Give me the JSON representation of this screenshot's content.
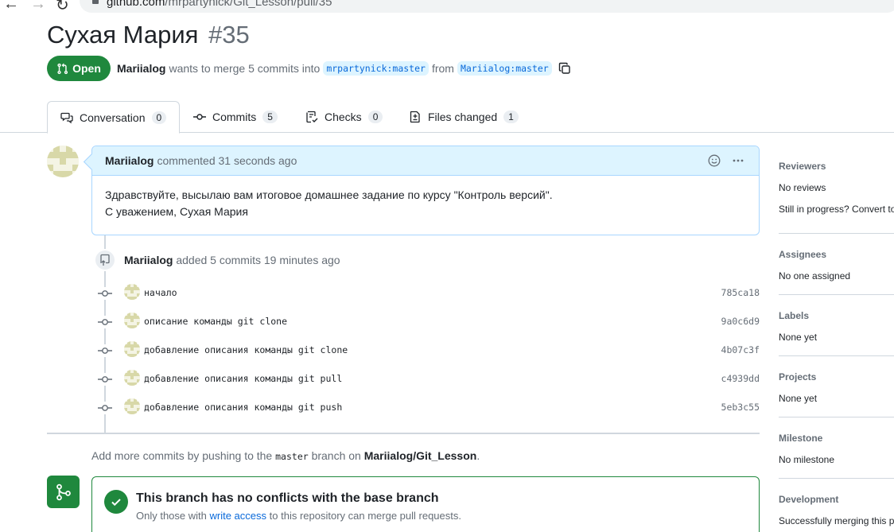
{
  "browser": {
    "url_host": "github.com",
    "url_path": "/mrpartynick/Git_Lesson/pull/35"
  },
  "pr": {
    "title": "Сухая Мария",
    "number": "#35",
    "state": "Open",
    "author": "Mariialog",
    "merge_text": "wants to merge 5 commits into",
    "base_branch": "mrpartynick:master",
    "from_text": "from",
    "head_branch": "Mariialog:master"
  },
  "tabs": [
    {
      "label": "Conversation",
      "count": "0",
      "icon": "comment-discussion-icon"
    },
    {
      "label": "Commits",
      "count": "5",
      "icon": "git-commit-icon"
    },
    {
      "label": "Checks",
      "count": "0",
      "icon": "checklist-icon"
    },
    {
      "label": "Files changed",
      "count": "1",
      "icon": "file-diff-icon"
    }
  ],
  "comment": {
    "author": "Mariialog",
    "action": "commented 31 seconds ago",
    "body_line1": "Здравствуйте, высылаю вам итоговое домашнее задание по курсу \"Контроль версий\".",
    "body_line2": "С уважением, Сухая Мария"
  },
  "commits_event": {
    "author": "Mariialog",
    "action": "added 5 commits 19 minutes ago"
  },
  "commits": [
    {
      "message": "начало",
      "sha": "785ca18"
    },
    {
      "message": "описание команды git clone",
      "sha": "9a0c6d9"
    },
    {
      "message": "добавление описания команды git clone",
      "sha": "4b07c3f"
    },
    {
      "message": "добавление описания команды git pull",
      "sha": "c4939dd"
    },
    {
      "message": "добавление описания команды git push",
      "sha": "5eb3c55"
    }
  ],
  "add_commits": {
    "prefix": "Add more commits by pushing to the",
    "branch": "master",
    "middle": "branch on",
    "repo": "Mariialog/Git_Lesson",
    "suffix": "."
  },
  "merge_status": {
    "title": "This branch has no conflicts with the base branch",
    "sub_prefix": "Only those with",
    "sub_link": "write access",
    "sub_suffix": "to this repository can merge pull requests."
  },
  "sidebar": {
    "reviewers": {
      "heading": "Reviewers",
      "value": "No reviews",
      "extra": "Still in progress? Convert to"
    },
    "assignees": {
      "heading": "Assignees",
      "value": "No one assigned"
    },
    "labels": {
      "heading": "Labels",
      "value": "None yet"
    },
    "projects": {
      "heading": "Projects",
      "value": "None yet"
    },
    "milestone": {
      "heading": "Milestone",
      "value": "No milestone"
    },
    "development": {
      "heading": "Development",
      "value": "Successfully merging this pu"
    }
  },
  "colors": {
    "open_green": "#1f883d",
    "link_blue": "#0969da",
    "comment_header_bg": "#ddf4ff"
  }
}
